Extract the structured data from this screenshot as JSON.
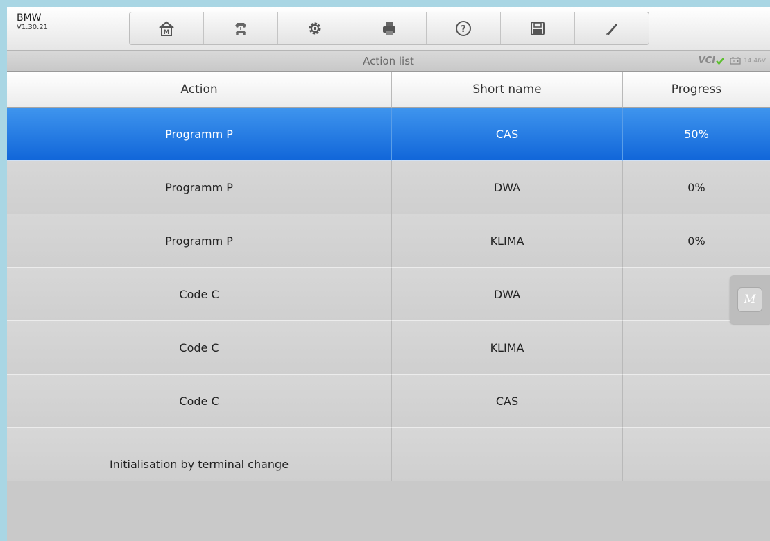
{
  "app": {
    "make": "BMW",
    "version": "V1.30.21"
  },
  "toolbar": [
    {
      "icon": "home-icon"
    },
    {
      "icon": "vehicle-swap-icon"
    },
    {
      "icon": "gear-icon"
    },
    {
      "icon": "printer-icon"
    },
    {
      "icon": "help-icon"
    },
    {
      "icon": "save-icon"
    },
    {
      "icon": "pencil-icon"
    }
  ],
  "titlebar": {
    "title": "Action list",
    "vci_label": "VCI",
    "battery_voltage": "14.46V"
  },
  "table": {
    "columns": [
      "Action",
      "Short name",
      "Progress"
    ],
    "rows": [
      {
        "action": "Programm P",
        "short_name": "CAS",
        "progress": "50%"
      },
      {
        "action": "Programm P",
        "short_name": "DWA",
        "progress": "0%"
      },
      {
        "action": "Programm P",
        "short_name": "KLIMA",
        "progress": "0%"
      },
      {
        "action": "Code C",
        "short_name": "DWA",
        "progress": ""
      },
      {
        "action": "Code C",
        "short_name": "KLIMA",
        "progress": ""
      },
      {
        "action": "Code C",
        "short_name": "CAS",
        "progress": ""
      },
      {
        "action": "Initialisation by terminal change",
        "short_name": "",
        "progress": ""
      }
    ],
    "selected_index": 0
  },
  "floating_button": {
    "label": "M"
  },
  "colors": {
    "selected_row": "#1f77e5",
    "vci_check": "#5cc02f"
  }
}
